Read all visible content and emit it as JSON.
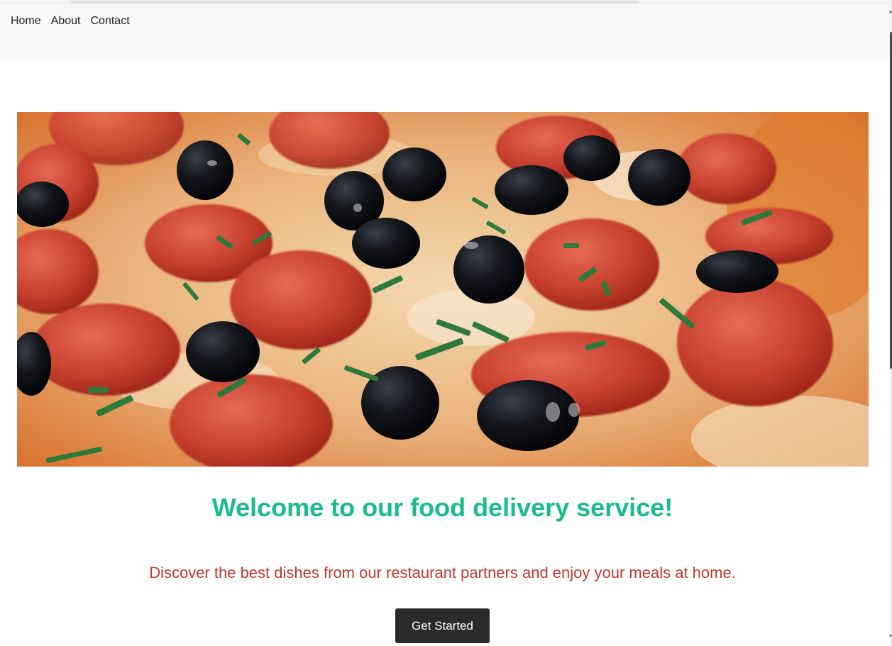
{
  "nav": {
    "items": [
      {
        "label": "Home"
      },
      {
        "label": "About"
      },
      {
        "label": "Contact"
      }
    ]
  },
  "hero": {
    "image": "pepperoni-olive-pizza-photo"
  },
  "main": {
    "headline": "Welcome to our food delivery service!",
    "tagline": "Discover the best dishes from our restaurant partners and enjoy your meals at home.",
    "cta_label": "Get Started"
  },
  "colors": {
    "headline": "#1abc8c",
    "tagline": "#c0392b",
    "cta_background": "#2b2b2b",
    "navbar_background": "#f7f7f7"
  }
}
